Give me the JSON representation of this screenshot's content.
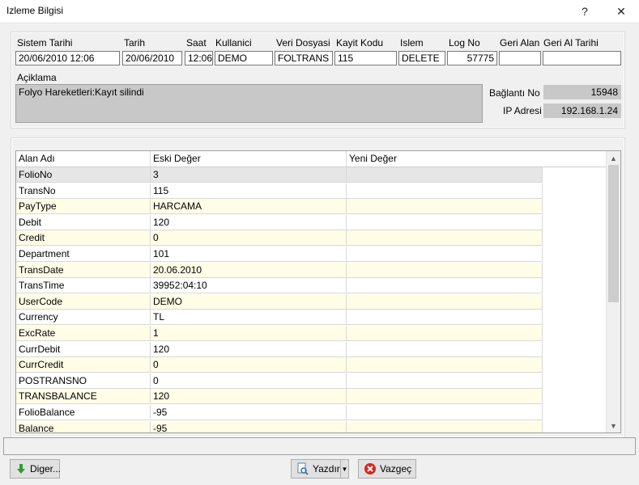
{
  "window": {
    "title": "Izleme Bilgisi",
    "help_label": "?",
    "close_label": "✕"
  },
  "header_fields": {
    "sistem_tarihi": {
      "label": "Sistem Tarihi",
      "value": "20/06/2010 12:06"
    },
    "tarih": {
      "label": "Tarih",
      "value": "20/06/2010"
    },
    "saat": {
      "label": "Saat",
      "value": "12:06:"
    },
    "kullanici": {
      "label": "Kullanici",
      "value": "DEMO"
    },
    "veri_dosyasi": {
      "label": "Veri Dosyasi",
      "value": "FOLTRANS"
    },
    "kayit_kodu": {
      "label": "Kayit Kodu",
      "value": "115"
    },
    "islem": {
      "label": "Islem",
      "value": "DELETE"
    },
    "log_no": {
      "label": "Log No",
      "value": "57775"
    },
    "geri_alan": {
      "label": "Geri Alan",
      "value": ""
    },
    "geri_al_tarihi": {
      "label": "Geri Al Tarihi",
      "value": ""
    }
  },
  "aciklama": {
    "label": "Açiklama",
    "value": "Folyo Hareketleri:Kayıt silindi"
  },
  "baglanti_no": {
    "label": "Bağlantı No",
    "value": "15948"
  },
  "ip_adresi": {
    "label": "IP Adresi",
    "value": "192.168.1.24"
  },
  "grid": {
    "columns": [
      "Alan Adı",
      "Eski Değer",
      "Yeni Değer"
    ],
    "rows": [
      [
        "FolioNo",
        "3",
        ""
      ],
      [
        "TransNo",
        "115",
        ""
      ],
      [
        "PayType",
        "HARCAMA",
        ""
      ],
      [
        "Debit",
        "120",
        ""
      ],
      [
        "Credit",
        "0",
        ""
      ],
      [
        "Department",
        "101",
        ""
      ],
      [
        "TransDate",
        "20.06.2010",
        ""
      ],
      [
        "TransTime",
        "39952:04:10",
        ""
      ],
      [
        "UserCode",
        "DEMO",
        ""
      ],
      [
        "Currency",
        "TL",
        ""
      ],
      [
        "ExcRate",
        "1",
        ""
      ],
      [
        "CurrDebit",
        "120",
        ""
      ],
      [
        "CurrCredit",
        "0",
        ""
      ],
      [
        "POSTRANSNO",
        "0",
        ""
      ],
      [
        "TRANSBALANCE",
        "120",
        ""
      ],
      [
        "FolioBalance",
        "-95",
        ""
      ],
      [
        "Balance",
        "-95",
        ""
      ]
    ]
  },
  "buttons": {
    "diger": "Diger...",
    "yazdir": "Yazdır",
    "vazgec": "Vazgeç"
  },
  "colors": {
    "alt_row": "#fffde6",
    "gray_field": "#c8c8c8",
    "diger_icon": "#2e9e2e",
    "vazgec_icon": "#d9261c"
  }
}
